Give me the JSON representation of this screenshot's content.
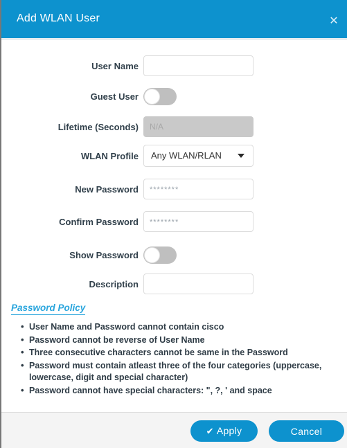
{
  "dialog": {
    "title": "Add WLAN User",
    "close_icon": "close-icon",
    "close_glyph": "✕"
  },
  "theme": {
    "header_blue": "#0d92ce",
    "link_blue": "#29a5dd",
    "label_color": "#31404b",
    "toggle_off_track": "#bfbfbf",
    "disabled_field": "#c9c9c9",
    "footer_bg": "#f4f4f4"
  },
  "form": {
    "fields": [
      {
        "label": "User Name",
        "type": "text",
        "name": "user-name",
        "value": "",
        "placeholder": "",
        "disabled": false
      },
      {
        "label": "Guest User",
        "type": "toggle",
        "name": "guest-user",
        "state": "off"
      },
      {
        "label": "Lifetime (Seconds)",
        "type": "text",
        "name": "lifetime-seconds",
        "value": "",
        "placeholder": "N/A",
        "disabled": true
      },
      {
        "label": "WLAN Profile",
        "type": "select",
        "name": "wlan-profile",
        "selected": "Any WLAN/RLAN",
        "arrow_icon": "chevron-down-icon"
      },
      {
        "label": "New Password",
        "type": "password",
        "name": "new-password",
        "value": "",
        "placeholder": "********",
        "disabled": false
      },
      {
        "label": "Confirm Password",
        "type": "password",
        "name": "confirm-password",
        "value": "",
        "placeholder": "********",
        "disabled": false
      },
      {
        "label": "Show Password",
        "type": "toggle",
        "name": "show-password",
        "state": "off"
      },
      {
        "label": "Description",
        "type": "text",
        "name": "description",
        "value": "",
        "placeholder": "",
        "disabled": false
      }
    ]
  },
  "policy": {
    "link_label": "Password Policy",
    "rules": [
      "User Name and Password cannot contain cisco",
      "Password cannot be reverse of User Name",
      "Three consecutive characters cannot be same in the Password",
      "Password must contain atleast three of the four categories (uppercase, lowercase, digit and special character)",
      "Password cannot have special characters: \", ?, ' and space"
    ]
  },
  "footer": {
    "apply_label": "Apply",
    "apply_icon": "check-icon",
    "apply_glyph": "✔",
    "cancel_label": "Cancel"
  }
}
